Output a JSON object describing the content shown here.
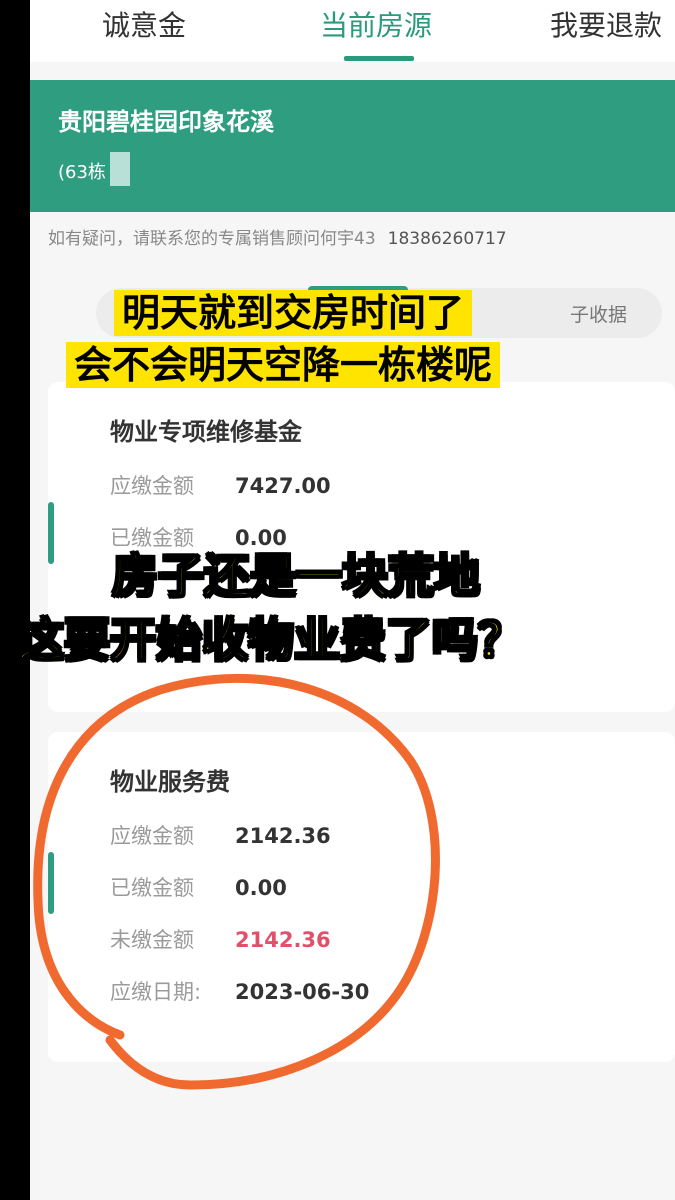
{
  "tabs": [
    {
      "label": "诚意金"
    },
    {
      "label": "当前房源"
    },
    {
      "label": "我要退款"
    }
  ],
  "project": {
    "name": "贵阳碧桂园印象花溪",
    "unit": "(63栋"
  },
  "contact": {
    "text": "如有疑问，请联系您的专属销售顾问何宇43",
    "phone": "18386260717"
  },
  "segment": {
    "label": "子收据"
  },
  "fees": [
    {
      "title": "物业专项维修基金",
      "rows": [
        {
          "label": "应缴金额",
          "value": "7427.00"
        },
        {
          "label": "已缴金额",
          "value": "0.00"
        }
      ]
    },
    {
      "title": "物业服务费",
      "rows": [
        {
          "label": "应缴金额",
          "value": "2142.36"
        },
        {
          "label": "已缴金额",
          "value": "0.00"
        },
        {
          "label": "未缴金额",
          "value": "2142.36"
        },
        {
          "label": "应缴日期:",
          "value": "2023-06-30"
        }
      ]
    }
  ],
  "captions": [
    "明天就到交房时间了",
    "会不会明天空降一栋楼呢",
    "房子还是一块荒地",
    "这要开始收物业费了吗？"
  ],
  "colors": {
    "accent": "#2f9d80",
    "unpaid": "#e0506a",
    "caption": "#ffe400",
    "annotation": "#f06a30"
  }
}
